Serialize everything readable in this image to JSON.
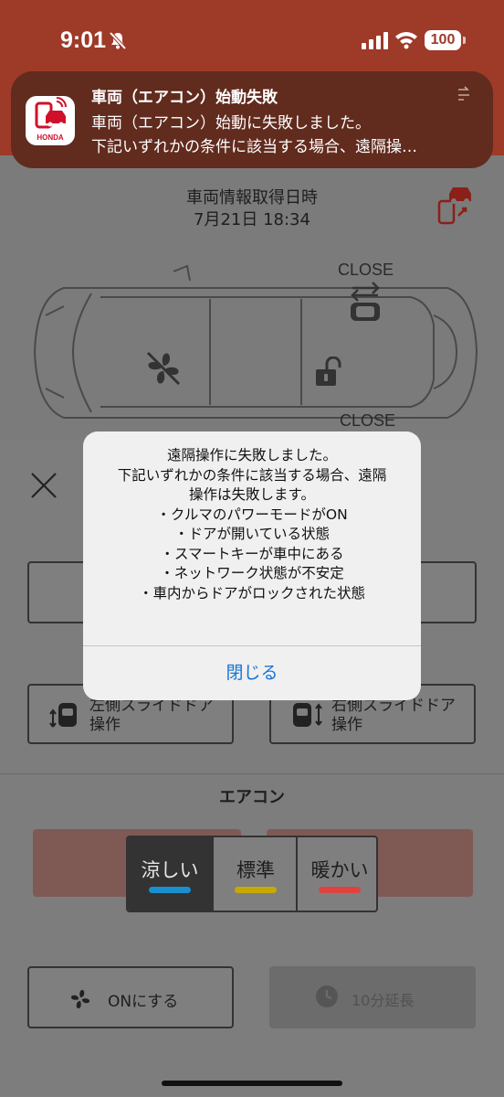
{
  "status_bar": {
    "time": "9:01",
    "battery": "100",
    "icons": [
      "mute-icon",
      "signal-icon",
      "wifi-icon"
    ]
  },
  "notification": {
    "app_brand": "HONDA",
    "title": "車両（エアコン）始動失敗",
    "line1": "車両（エアコン）始動に失敗しました。",
    "line2": "下記いずれかの条件に該当する場合、遠隔操…"
  },
  "vehicle": {
    "info_title": "車両情報取得日時",
    "info_date": "7月21日 18:34",
    "door_top": "CLOSE",
    "door_bottom": "CLOSE"
  },
  "slide_doors": {
    "left": {
      "line1": "左側スライドドア",
      "line2": "操作"
    },
    "right": {
      "line1": "右側スライドドア",
      "line2": "操作"
    }
  },
  "aircon": {
    "title": "エアコン",
    "modes": [
      {
        "label": "涼しい",
        "color": "#1a8fd0",
        "selected": true
      },
      {
        "label": "標準",
        "color": "#c8a800",
        "selected": false
      },
      {
        "label": "暖かい",
        "color": "#e0433f",
        "selected": false
      }
    ],
    "on_button": "ONにする",
    "extend_button": "10分延長"
  },
  "alert": {
    "lines": [
      "遠隔操作に失敗しました。",
      "下記いずれかの条件に該当する場合、遠隔",
      "操作は失敗します。",
      "・クルマのパワーモードがON",
      "・ドアが開いている状態",
      "・スマートキーが車中にある",
      "・ネットワーク状態が不安定",
      "・車内からドアがロックされた状態"
    ],
    "close_label": "閉じる"
  },
  "colors": {
    "header_red": "#9e3a28",
    "notification_bg": "#612b1e",
    "alert_button": "#1474d8"
  }
}
